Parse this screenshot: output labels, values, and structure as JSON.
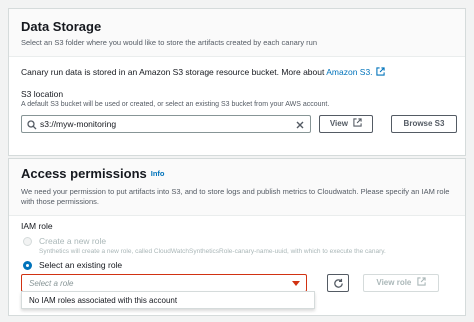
{
  "data_storage": {
    "title": "Data Storage",
    "description": "Select an S3 folder where you would like to store the artifacts created by each canary run",
    "storage_text": "Canary run data is stored in an Amazon S3 storage resource bucket. More about ",
    "storage_link": "Amazon S3.",
    "s3_location": {
      "label": "S3 location",
      "description": "A default S3 bucket will be used or created, or select an existing S3 bucket from your AWS account.",
      "value": "s3://myw-monitoring"
    },
    "view_button": "View",
    "browse_button": "Browse S3"
  },
  "access_permissions": {
    "title": "Access permissions",
    "info": "Info",
    "description": "We need your permission to put artifacts into S3, and to store logs and publish metrics to Cloudwatch. Please specify an IAM role with those permissions.",
    "iam_role_label": "IAM role",
    "options": {
      "create": {
        "label": "Create a new role",
        "description": "Synthetics will create a new role, called CloudWatchSyntheticsRole-canary-name-uuid, with which to execute the canary."
      },
      "existing": {
        "label": "Select an existing role"
      }
    },
    "select_placeholder": "Select a role",
    "view_role_button": "View role",
    "dropdown_message": "No IAM roles associated with this account"
  },
  "colors": {
    "link": "#0073bb",
    "error": "#d13212",
    "text": "#16191f",
    "muted": "#545b64"
  }
}
